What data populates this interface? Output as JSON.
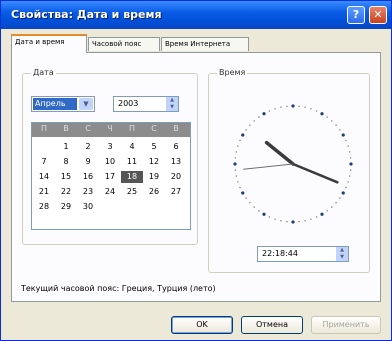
{
  "window": {
    "title": "Свойства: Дата и время",
    "help_glyph": "?",
    "close_glyph": "✕"
  },
  "tabs": [
    {
      "label": "Дата и время",
      "active": true
    },
    {
      "label": "Часовой пояс",
      "active": false
    },
    {
      "label": "Время Интернета",
      "active": false
    }
  ],
  "date_group": {
    "label": "Дата",
    "month": "Апрель",
    "year": "2003",
    "weekdays": [
      "П",
      "В",
      "С",
      "Ч",
      "П",
      "С",
      "В"
    ],
    "weeks": [
      [
        "",
        "1",
        "2",
        "3",
        "4",
        "5",
        "6"
      ],
      [
        "7",
        "8",
        "9",
        "10",
        "11",
        "12",
        "13"
      ],
      [
        "14",
        "15",
        "16",
        "17",
        "18",
        "19",
        "20"
      ],
      [
        "21",
        "22",
        "23",
        "24",
        "25",
        "26",
        "27"
      ],
      [
        "28",
        "29",
        "30",
        "",
        "",
        "",
        ""
      ]
    ],
    "selected_day": "18"
  },
  "time_group": {
    "label": "Время",
    "time": "22:18:44"
  },
  "timezone_text": "Текущий часовой пояс: Греция, Турция (лето)",
  "buttons": {
    "ok": "OK",
    "cancel": "Отмена",
    "apply": "Применить"
  },
  "colors": {
    "title_bar": "#0a5ce6",
    "calendar_header": "#8c8c8c",
    "selected_day_bg": "#555555"
  }
}
